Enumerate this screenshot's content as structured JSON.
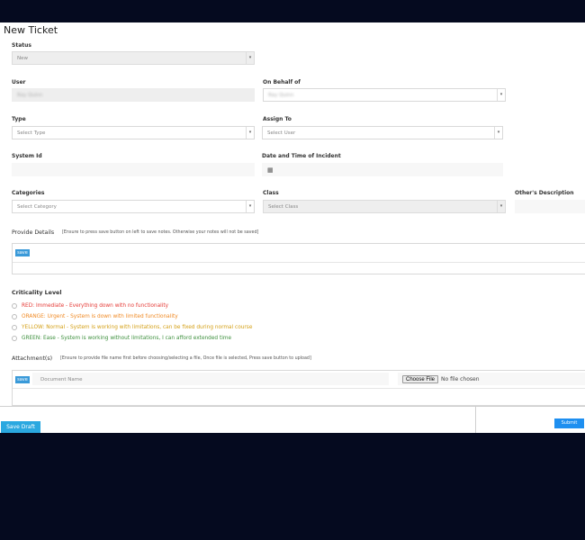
{
  "page": {
    "title": "New Ticket"
  },
  "form": {
    "status": {
      "label": "Status",
      "value": "New"
    },
    "user": {
      "label": "User",
      "value": "Ray Quinn"
    },
    "on_behalf": {
      "label": "On Behalf of",
      "value": "Ray Quinn"
    },
    "type": {
      "label": "Type",
      "placeholder": "Select Type"
    },
    "assign_to": {
      "label": "Assign To",
      "placeholder": "Select User"
    },
    "system_id": {
      "label": "System Id",
      "value": ""
    },
    "date_time": {
      "label": "Date and Time of Incident",
      "icon": "calendar-icon"
    },
    "categories": {
      "label": "Categories",
      "placeholder": "Select Category"
    },
    "class": {
      "label": "Class",
      "placeholder": "Select Class"
    },
    "others_description": {
      "label": "Other's Description"
    }
  },
  "details": {
    "label": "Provide Details",
    "note": "[Ensure to press save button on left to save notes. Otherwise your notes will not be saved]",
    "save_label": "save"
  },
  "criticality": {
    "label": "Criticality Level",
    "options": [
      {
        "text": "RED: Immediate - Everything down with no functionality",
        "color": "#e53935"
      },
      {
        "text": "ORANGE: Urgent - System is down with limited functionality",
        "color": "#f08a24"
      },
      {
        "text": "YELLOW: Normal - System is working with limitations, can be fixed during normal course",
        "color": "#d4a017"
      },
      {
        "text": "GREEN: Ease - System is working without limitations, I can afford extended time",
        "color": "#3c8f3c"
      }
    ]
  },
  "attachments": {
    "label": "Attachment(s)",
    "note": "[Ensure to provide file name first before choosing/selecting a file, Once file is selected, Press save button to upload]",
    "save_label": "save",
    "document_placeholder": "Document Name",
    "choose_file_label": "Choose File",
    "no_file_text": "No file chosen"
  },
  "actions": {
    "save_draft": "Save Draft",
    "submit": "Submit"
  },
  "colors": {
    "background": "#050a1f",
    "accent": "#2aa8e0",
    "submit": "#1e8ff0"
  }
}
